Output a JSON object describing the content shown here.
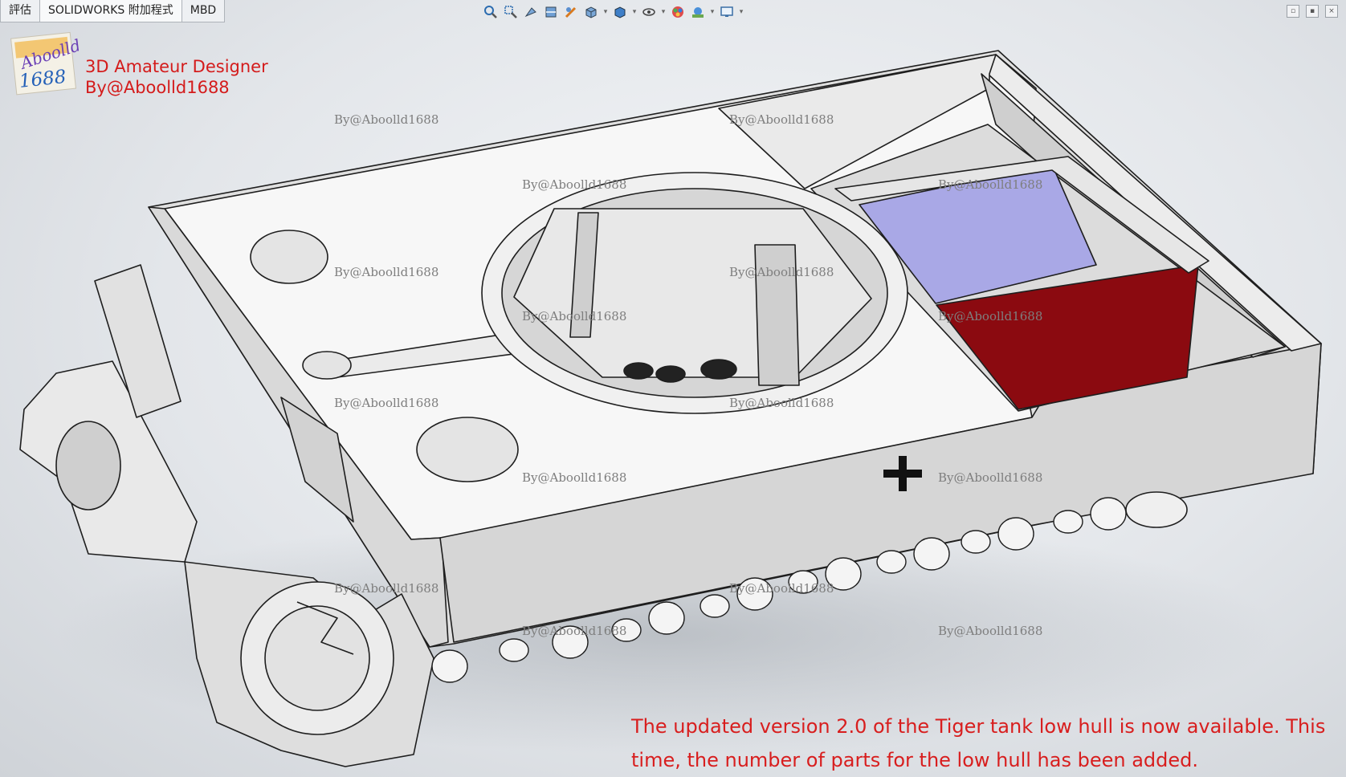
{
  "menu_tabs": [
    {
      "label": "評估"
    },
    {
      "label": "SOLIDWORKS 附加程式"
    },
    {
      "label": "MBD"
    }
  ],
  "toolbar_icons": [
    "zoom-to-fit-icon",
    "zoom-to-area-icon",
    "previous-view-icon",
    "section-view-icon",
    "dynamic-annotation-icon",
    "view-orientation-icon",
    "display-style-icon",
    "hide-show-items-icon",
    "edit-appearance-icon",
    "apply-scene-icon",
    "view-settings-icon"
  ],
  "brand": {
    "logo_text_top": "Aboolld",
    "logo_text_bottom": "1688",
    "line1": "3D Amateur Designer",
    "line2": "By@Aboolld1688"
  },
  "watermark_text": "By@Aboolld1688",
  "caption": {
    "line1": "The updated version 2.0 of the Tiger tank low hull is now available. This",
    "line2": "time, the number of parts for the low hull has been added."
  },
  "colors": {
    "brand_red": "#d41b1b",
    "panel_red": "#8b0a10",
    "engine_bay_blue": "#a9a8e6",
    "hull_grey": "#e6e6e6",
    "deck_white": "#f7f7f7"
  }
}
